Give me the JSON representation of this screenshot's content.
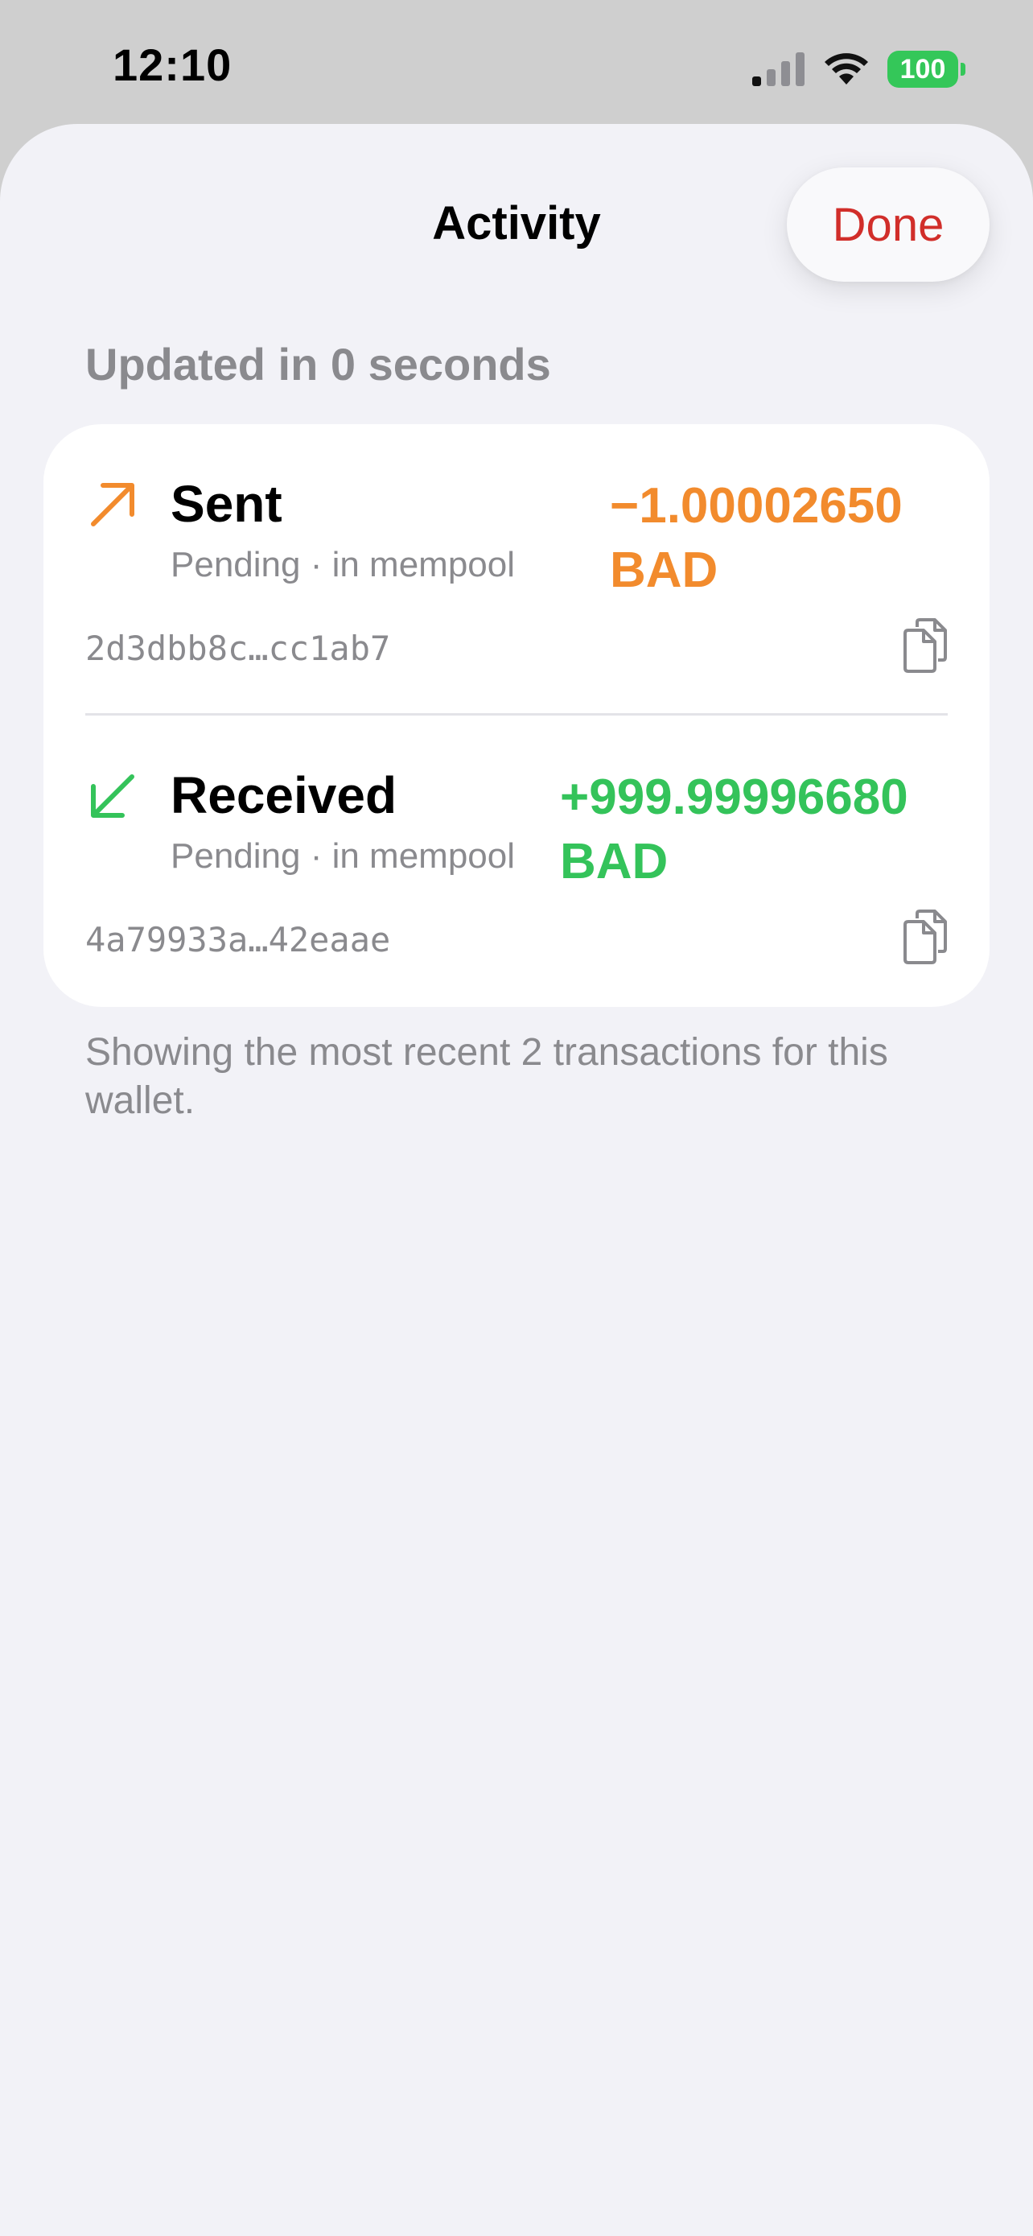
{
  "status_bar": {
    "time": "12:10",
    "battery_level": "100",
    "icons": [
      "cellular-signal-icon",
      "wifi-icon",
      "battery-icon"
    ],
    "battery_color": "#34c759"
  },
  "sheet": {
    "title": "Activity",
    "done_label": "Done",
    "updated_text": "Updated in 0 seconds"
  },
  "transactions": [
    {
      "kind": "Sent",
      "status": "Pending · in mempool",
      "amount": "−1.00002650",
      "unit": "BAD",
      "hash": "2d3dbb8c…cc1ab7",
      "icon": "arrow-up-right-icon",
      "color": "#f28b2d"
    },
    {
      "kind": "Received",
      "status": "Pending · in mempool",
      "amount": "+999.99996680",
      "unit": "BAD",
      "hash": "4a79933a…42eaae",
      "icon": "arrow-down-left-icon",
      "color": "#34c35a"
    }
  ],
  "footer": {
    "note": "Showing the most recent 2 transactions for this wallet."
  },
  "colors": {
    "done_red": "#d12e2a",
    "secondary_text": "#8a8a8e",
    "sheet_background": "#f2f2f7"
  }
}
